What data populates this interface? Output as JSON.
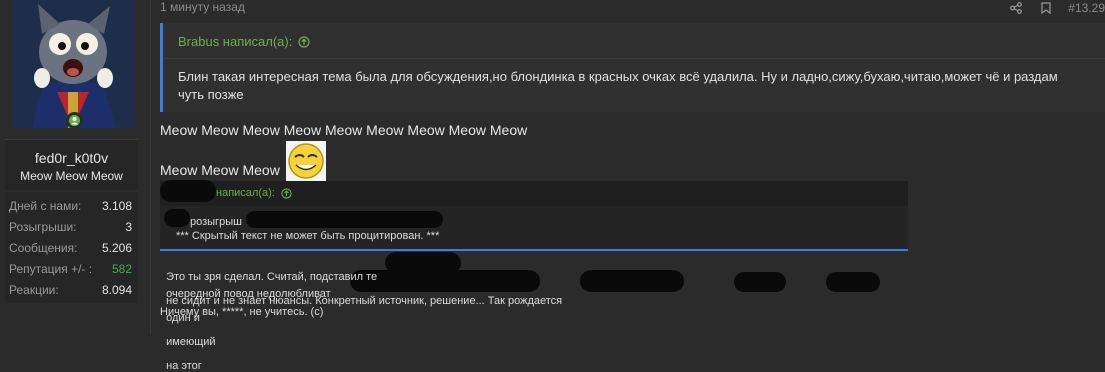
{
  "user": {
    "name": "fed0r_k0t0v",
    "title": "Meow Meow Meow",
    "stats": [
      {
        "label": "Дней с нами:",
        "value": "3.108",
        "green": false
      },
      {
        "label": "Розыгрыши:",
        "value": "3",
        "green": false
      },
      {
        "label": "Сообщения:",
        "value": "5.206",
        "green": false
      },
      {
        "label": "Репутация +/- :",
        "value": "582",
        "green": true
      },
      {
        "label": "Реакции:",
        "value": "8.094",
        "green": false
      }
    ]
  },
  "post": {
    "time": "1 минуту назад",
    "number": "#13.29",
    "quote": {
      "author": "Brabus написал(а):",
      "text": "Блин такая интересная тема была для обсуждения,но блондинка в красных очках всё удалила. Ну и ладно,сижу,бухаю,читаю,может чё и раздам чуть позже"
    },
    "line1": "Meow Meow Meow Meow Meow Meow Meow Meow Meow",
    "line2": "Meow Meow Meow",
    "nested_quote": {
      "author": "написал(а):",
      "line1": "розыгрыш",
      "line2": "*** Скрытый текст не может быть процитирован. ***"
    },
    "body": {
      "p1a": "Это ты зря сделал. Считай, подставил те",
      "p1b": "не сидит и не знает нюансы. Конкретный источник, решение... Так рождается",
      "p2a": "очередной повод недолюбливат",
      "p2b": "один и",
      "p2c": "имеющий",
      "p2d": "на этог",
      "p3": "Ничему вы, *****, не учитесь. (с)"
    }
  },
  "colors": {
    "accent_blue": "#3d7be0",
    "green": "#6fae4c",
    "background": "#2b2b2b"
  }
}
